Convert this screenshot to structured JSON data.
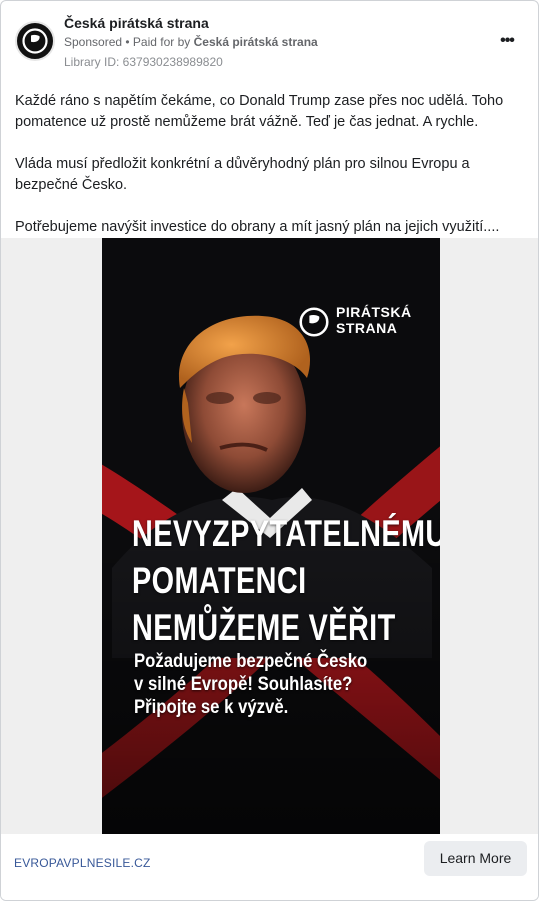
{
  "post": {
    "page_name": "Česká pirátská strana",
    "sponsored_label": "Sponsored",
    "paid_for_prefix": " • Paid for by ",
    "paid_for_name": "Česká pirátská strana",
    "library_id": "Library ID: 637930238989820",
    "more_label": "•••",
    "body_paragraphs": [
      "Každé ráno s napětím čekáme, co Donald Trump zase přes noc udělá. Toho pomatence už prostě nemůžeme brát vážně. Teď je čas jednat. A rychle.",
      "Vláda musí předložit konkrétní a důvěryhodný plán pro silnou Evropu a bezpečné Česko.",
      "Potřebujeme navýšit investice do obrany a mít jasný plán na jejich využití...."
    ]
  },
  "creative": {
    "brand_line1": "PIRÁTSKÁ",
    "brand_line2": "STRANA",
    "headline": [
      "NEVYZPYTATELNÉMU",
      "POMATENCI",
      "NEMŮŽEME VĚŘIT"
    ],
    "subtext": [
      "Požadujeme bezpečné Česko",
      "v silné Evropě! Souhlasíte?",
      "Připojte se k výzvě."
    ],
    "colors": {
      "background": "#0b0b0d",
      "cross": "#b3171b",
      "text": "#ffffff"
    }
  },
  "footer": {
    "link_domain": "EVROPAVPLNESILE.CZ",
    "cta_label": "Learn More"
  },
  "icons": {
    "avatar": "pirate-flag-icon",
    "more": "more-dots-icon"
  }
}
